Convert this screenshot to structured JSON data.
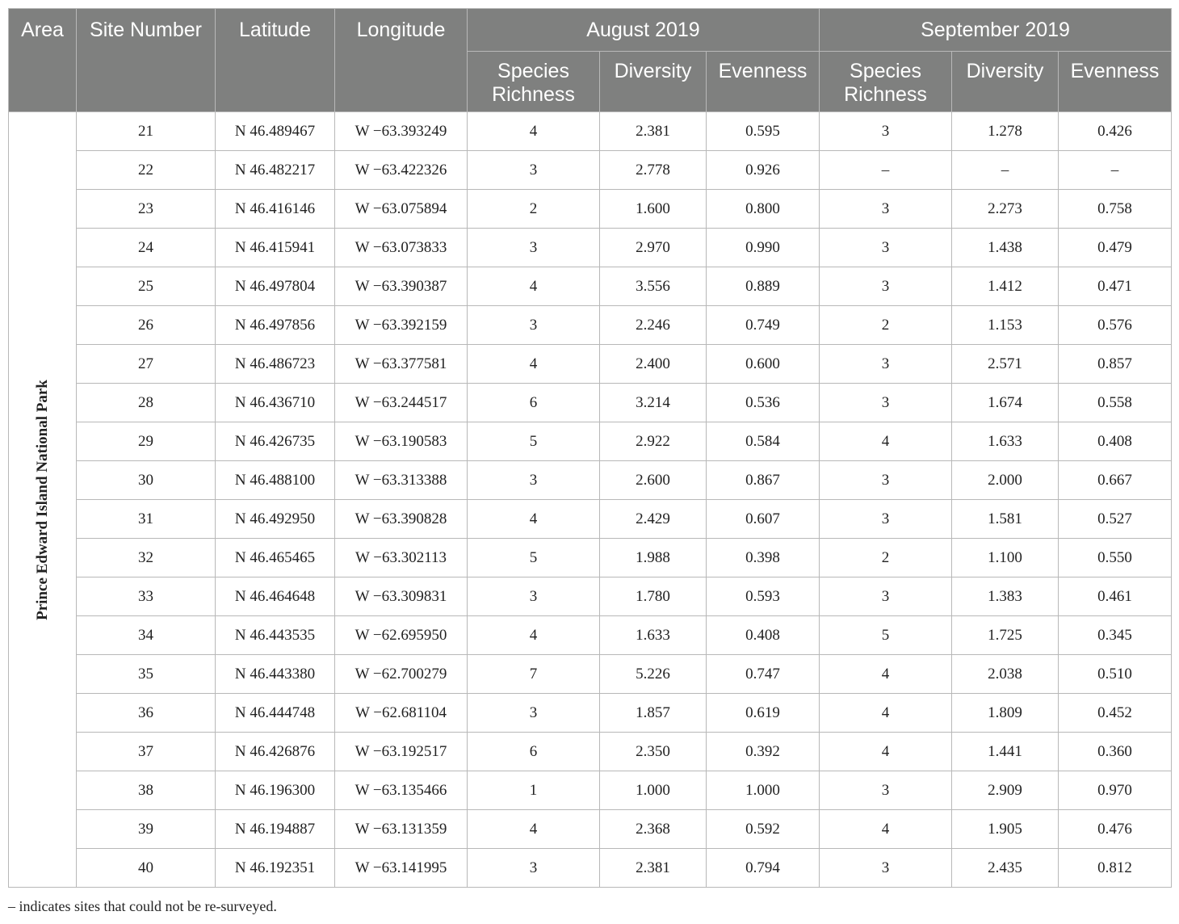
{
  "headers": {
    "area": "Area",
    "site_number": "Site Number",
    "latitude": "Latitude",
    "longitude": "Longitude",
    "august": "August 2019",
    "september": "September 2019",
    "aug_richness": "Species Richness",
    "aug_diversity": "Diversity",
    "aug_evenness": "Evenness",
    "sep_richness": "Species Richness",
    "sep_diversity": "Diversity",
    "sep_evenness": "Evenness"
  },
  "area_name": "Prince Edward Island National Park",
  "rows": [
    {
      "site": "21",
      "lat": "N 46.489467",
      "lon": "W −63.393249",
      "aug_sr": "4",
      "aug_div": "2.381",
      "aug_even": "0.595",
      "sep_sr": "3",
      "sep_div": "1.278",
      "sep_even": "0.426"
    },
    {
      "site": "22",
      "lat": "N 46.482217",
      "lon": "W −63.422326",
      "aug_sr": "3",
      "aug_div": "2.778",
      "aug_even": "0.926",
      "sep_sr": "–",
      "sep_div": "–",
      "sep_even": "–"
    },
    {
      "site": "23",
      "lat": "N 46.416146",
      "lon": "W −63.075894",
      "aug_sr": "2",
      "aug_div": "1.600",
      "aug_even": "0.800",
      "sep_sr": "3",
      "sep_div": "2.273",
      "sep_even": "0.758"
    },
    {
      "site": "24",
      "lat": "N 46.415941",
      "lon": "W −63.073833",
      "aug_sr": "3",
      "aug_div": "2.970",
      "aug_even": "0.990",
      "sep_sr": "3",
      "sep_div": "1.438",
      "sep_even": "0.479"
    },
    {
      "site": "25",
      "lat": "N 46.497804",
      "lon": "W −63.390387",
      "aug_sr": "4",
      "aug_div": "3.556",
      "aug_even": "0.889",
      "sep_sr": "3",
      "sep_div": "1.412",
      "sep_even": "0.471"
    },
    {
      "site": "26",
      "lat": "N 46.497856",
      "lon": "W −63.392159",
      "aug_sr": "3",
      "aug_div": "2.246",
      "aug_even": "0.749",
      "sep_sr": "2",
      "sep_div": "1.153",
      "sep_even": "0.576"
    },
    {
      "site": "27",
      "lat": "N 46.486723",
      "lon": "W −63.377581",
      "aug_sr": "4",
      "aug_div": "2.400",
      "aug_even": "0.600",
      "sep_sr": "3",
      "sep_div": "2.571",
      "sep_even": "0.857"
    },
    {
      "site": "28",
      "lat": "N 46.436710",
      "lon": "W −63.244517",
      "aug_sr": "6",
      "aug_div": "3.214",
      "aug_even": "0.536",
      "sep_sr": "3",
      "sep_div": "1.674",
      "sep_even": "0.558"
    },
    {
      "site": "29",
      "lat": "N 46.426735",
      "lon": "W −63.190583",
      "aug_sr": "5",
      "aug_div": "2.922",
      "aug_even": "0.584",
      "sep_sr": "4",
      "sep_div": "1.633",
      "sep_even": "0.408"
    },
    {
      "site": "30",
      "lat": "N 46.488100",
      "lon": "W −63.313388",
      "aug_sr": "3",
      "aug_div": "2.600",
      "aug_even": "0.867",
      "sep_sr": "3",
      "sep_div": "2.000",
      "sep_even": "0.667"
    },
    {
      "site": "31",
      "lat": "N 46.492950",
      "lon": "W −63.390828",
      "aug_sr": "4",
      "aug_div": "2.429",
      "aug_even": "0.607",
      "sep_sr": "3",
      "sep_div": "1.581",
      "sep_even": "0.527"
    },
    {
      "site": "32",
      "lat": "N 46.465465",
      "lon": "W −63.302113",
      "aug_sr": "5",
      "aug_div": "1.988",
      "aug_even": "0.398",
      "sep_sr": "2",
      "sep_div": "1.100",
      "sep_even": "0.550"
    },
    {
      "site": "33",
      "lat": "N 46.464648",
      "lon": "W −63.309831",
      "aug_sr": "3",
      "aug_div": "1.780",
      "aug_even": "0.593",
      "sep_sr": "3",
      "sep_div": "1.383",
      "sep_even": "0.461"
    },
    {
      "site": "34",
      "lat": "N 46.443535",
      "lon": "W −62.695950",
      "aug_sr": "4",
      "aug_div": "1.633",
      "aug_even": "0.408",
      "sep_sr": "5",
      "sep_div": "1.725",
      "sep_even": "0.345"
    },
    {
      "site": "35",
      "lat": "N 46.443380",
      "lon": "W −62.700279",
      "aug_sr": "7",
      "aug_div": "5.226",
      "aug_even": "0.747",
      "sep_sr": "4",
      "sep_div": "2.038",
      "sep_even": "0.510"
    },
    {
      "site": "36",
      "lat": "N 46.444748",
      "lon": "W −62.681104",
      "aug_sr": "3",
      "aug_div": "1.857",
      "aug_even": "0.619",
      "sep_sr": "4",
      "sep_div": "1.809",
      "sep_even": "0.452"
    },
    {
      "site": "37",
      "lat": "N 46.426876",
      "lon": "W −63.192517",
      "aug_sr": "6",
      "aug_div": "2.350",
      "aug_even": "0.392",
      "sep_sr": "4",
      "sep_div": "1.441",
      "sep_even": "0.360"
    },
    {
      "site": "38",
      "lat": "N 46.196300",
      "lon": "W −63.135466",
      "aug_sr": "1",
      "aug_div": "1.000",
      "aug_even": "1.000",
      "sep_sr": "3",
      "sep_div": "2.909",
      "sep_even": "0.970"
    },
    {
      "site": "39",
      "lat": "N 46.194887",
      "lon": "W −63.131359",
      "aug_sr": "4",
      "aug_div": "2.368",
      "aug_even": "0.592",
      "sep_sr": "4",
      "sep_div": "1.905",
      "sep_even": "0.476"
    },
    {
      "site": "40",
      "lat": "N 46.192351",
      "lon": "W −63.141995",
      "aug_sr": "3",
      "aug_div": "2.381",
      "aug_even": "0.794",
      "sep_sr": "3",
      "sep_div": "2.435",
      "sep_even": "0.812"
    }
  ],
  "footnote": "– indicates sites that could not be re-surveyed.",
  "colors": {
    "header_bg": "#7f807f",
    "header_text": "#ffffff",
    "border": "#b8b8b8"
  }
}
